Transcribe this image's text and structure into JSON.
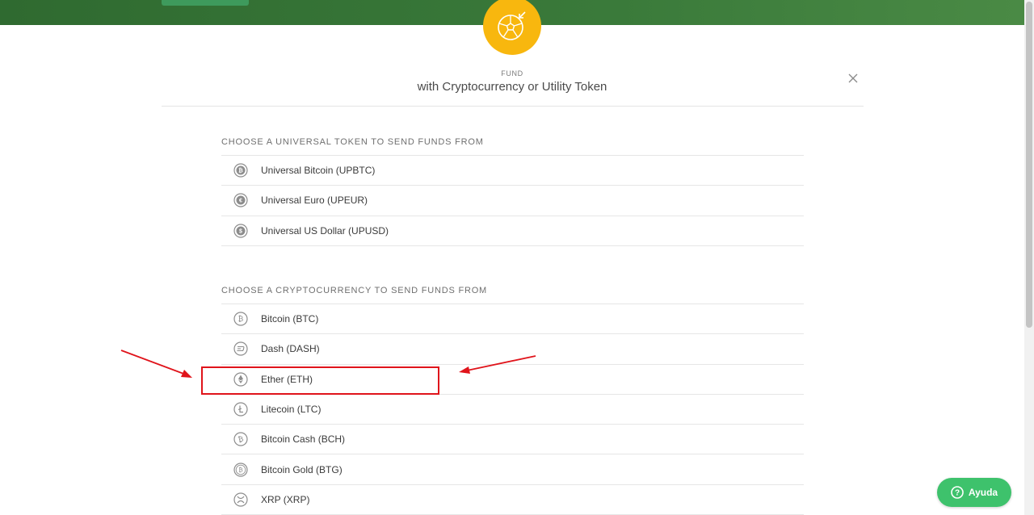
{
  "header": {
    "label": "FUND",
    "title": "with Cryptocurrency or Utility Token",
    "badge_icon": "crypto-globe-icon",
    "close_icon": "close-icon"
  },
  "universal_section": {
    "heading": "CHOOSE A UNIVERSAL TOKEN TO SEND FUNDS FROM",
    "items": [
      {
        "label": "Universal Bitcoin (UPBTC)",
        "icon": "universal-bitcoin-icon"
      },
      {
        "label": "Universal Euro (UPEUR)",
        "icon": "universal-euro-icon"
      },
      {
        "label": "Universal US Dollar (UPUSD)",
        "icon": "universal-dollar-icon"
      }
    ]
  },
  "crypto_section": {
    "heading": "CHOOSE A CRYPTOCURRENCY TO SEND FUNDS FROM",
    "items": [
      {
        "label": "Bitcoin (BTC)",
        "icon": "bitcoin-icon"
      },
      {
        "label": "Dash (DASH)",
        "icon": "dash-icon"
      },
      {
        "label": "Ether (ETH)",
        "icon": "ether-icon"
      },
      {
        "label": "Litecoin (LTC)",
        "icon": "litecoin-icon"
      },
      {
        "label": "Bitcoin Cash (BCH)",
        "icon": "bitcoin-cash-icon"
      },
      {
        "label": "Bitcoin Gold (BTG)",
        "icon": "bitcoin-gold-icon"
      },
      {
        "label": "XRP (XRP)",
        "icon": "xrp-icon"
      }
    ]
  },
  "help_button": {
    "label": "Ayuda",
    "icon": "question-icon"
  },
  "colors": {
    "badge": "#f8b70e",
    "top_band": "#3a7a3a",
    "help_button": "#3ec26c",
    "highlight": "#e0141b"
  }
}
